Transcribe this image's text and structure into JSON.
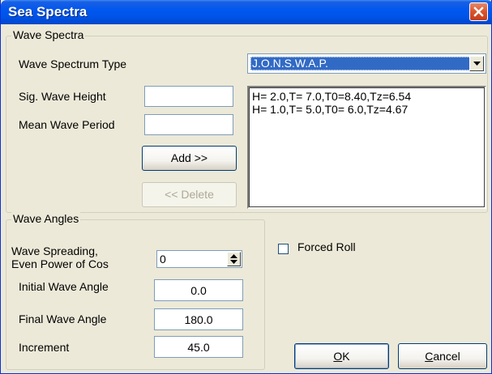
{
  "window": {
    "title": "Sea Spectra",
    "close_icon": "close-x-icon"
  },
  "wave_spectra": {
    "group_label": "Wave Spectra",
    "spectrum_type_label": "Wave Spectrum Type",
    "spectrum_type_value": "J.O.N.S.W.A.P.",
    "sig_wave_height_label": "Sig. Wave Height",
    "sig_wave_height_value": "",
    "mean_wave_period_label": "Mean Wave Period",
    "mean_wave_period_value": "",
    "add_button": "Add >>",
    "delete_button": "<< Delete",
    "list_items": [
      "H= 2.0,T= 7.0,T0=8.40,Tz=6.54",
      "H= 1.0,T= 5.0,T0= 6.0,Tz=4.67"
    ]
  },
  "wave_angles": {
    "group_label": "Wave Angles",
    "spreading_label_line1": "Wave Spreading,",
    "spreading_label_line2": "Even Power of Cos",
    "spreading_value": "0",
    "initial_angle_label": "Initial Wave Angle",
    "initial_angle_value": "0.0",
    "final_angle_label": "Final Wave Angle",
    "final_angle_value": "180.0",
    "increment_label": "Increment",
    "increment_value": "45.0"
  },
  "forced_roll": {
    "label": "Forced Roll",
    "checked": false
  },
  "buttons": {
    "ok_mnemonic": "O",
    "ok_rest": "K",
    "cancel_mnemonic": "C",
    "cancel_rest": "ancel"
  },
  "colors": {
    "titlebar": "#0053E8",
    "selection": "#316AC5",
    "dialog_bg": "#ECE9D8"
  }
}
